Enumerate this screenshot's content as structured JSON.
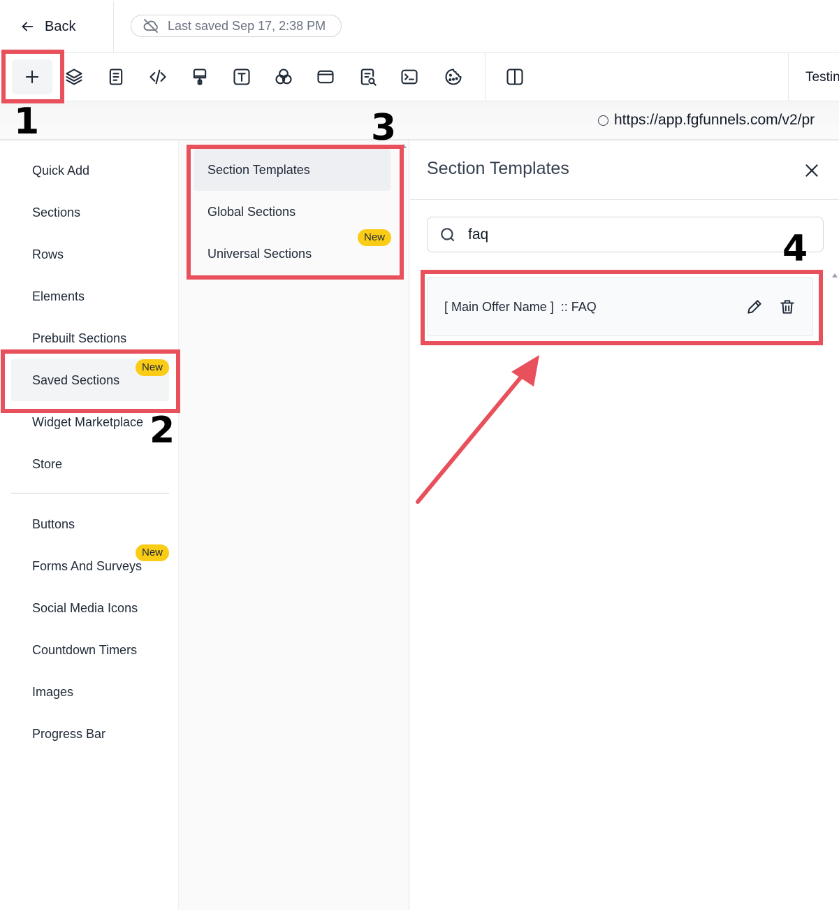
{
  "topbar": {
    "back_label": "Back",
    "last_saved": "Last saved Sep 17, 2:38 PM"
  },
  "toolbar": {
    "tools": [
      "plus-icon",
      "layers-icon",
      "page-icon",
      "code-icon",
      "paint-brush-icon",
      "text-icon",
      "circles-icon",
      "window-icon",
      "search-doc-icon",
      "terminal-icon",
      "cookie-icon",
      "split-view-icon"
    ],
    "right_label": "Testin"
  },
  "urlbar": {
    "url": "https://app.fgfunnels.com/v2/pr"
  },
  "left_nav": {
    "items": [
      "Quick Add",
      "Sections",
      "Rows",
      "Elements",
      "Prebuilt Sections",
      "Saved Sections",
      "Widget Marketplace",
      "Store"
    ],
    "items2": [
      "Buttons",
      "Forms And Surveys",
      "Social Media Icons",
      "Countdown Timers",
      "Images",
      "Progress Bar"
    ],
    "selected": "Saved Sections",
    "badge": "New"
  },
  "mid_nav": {
    "items": [
      "Section Templates",
      "Global Sections",
      "Universal Sections"
    ],
    "selected": "Section Templates",
    "badge": "New"
  },
  "panel": {
    "title": "Section Templates",
    "search_value": "faq",
    "result": "[ Main Offer Name ]  :: FAQ"
  },
  "annotations": [
    "1",
    "2",
    "3",
    "4"
  ],
  "colors": {
    "annotation": "#e8505b",
    "badge": "#facc15"
  }
}
